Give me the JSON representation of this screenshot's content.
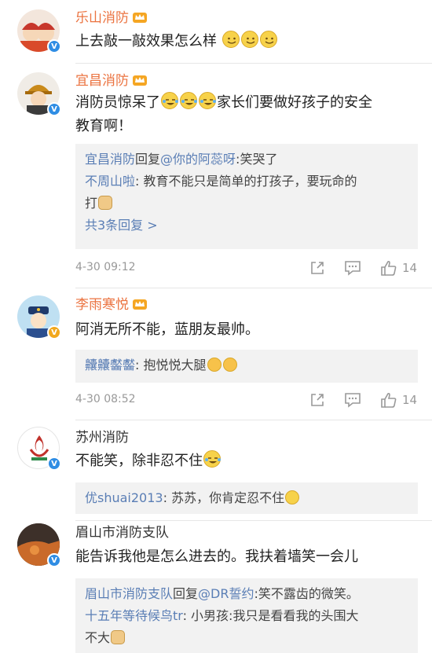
{
  "comments": [
    {
      "user": "乐山消防",
      "text": "上去敲一敲效果怎么样",
      "emojis": [
        "smile-emoji",
        "smile-emoji",
        "smile-emoji"
      ]
    },
    {
      "user": "宜昌消防",
      "text_line1": "消防员惊呆了",
      "text_line1_after": "家长们要做好孩子的安全",
      "text_line2": "教育啊！",
      "replies": [
        {
          "who": "宜昌消防",
          "mid": "回复",
          "target": "@你的阿蕊呀",
          "content": ":笑哭了"
        },
        {
          "who": "不周山啦",
          "content_line1": ": 教育不能只是简单的打孩子，要玩命的",
          "content_line2": "打"
        }
      ],
      "more": "共3条回复 >",
      "date": "4-30 09:12",
      "likes": "14"
    },
    {
      "user": "李雨寒悦",
      "text": "阿消无所不能，蓝朋友最帅。",
      "replies": [
        {
          "who": "齉齉齾齾",
          "content": ": 抱悦悦大腿"
        }
      ],
      "date": "4-30 08:52",
      "likes": "14"
    },
    {
      "user": "苏州消防",
      "text": "不能笑，除非忍不住",
      "replies": [
        {
          "who": "优shuai2013",
          "content": ": 苏苏，你肯定忍不住"
        }
      ]
    },
    {
      "user": "眉山市消防支队",
      "text": "能告诉我他是怎么进去的。我扶着墙笑一会儿",
      "replies": [
        {
          "who": "眉山市消防支队",
          "mid": "回复",
          "target": "@DR誓约",
          "content": ":笑不露齿的微笑。"
        },
        {
          "who": "十五年等待候鸟tr",
          "content_line1": ": 小男孩:我只是看看我的头围大",
          "content_line2": "不大"
        }
      ]
    }
  ],
  "colors": {
    "name_orange": "#eb7340",
    "link_blue": "#5a7eb5",
    "reply_bg": "#f2f2f2"
  }
}
